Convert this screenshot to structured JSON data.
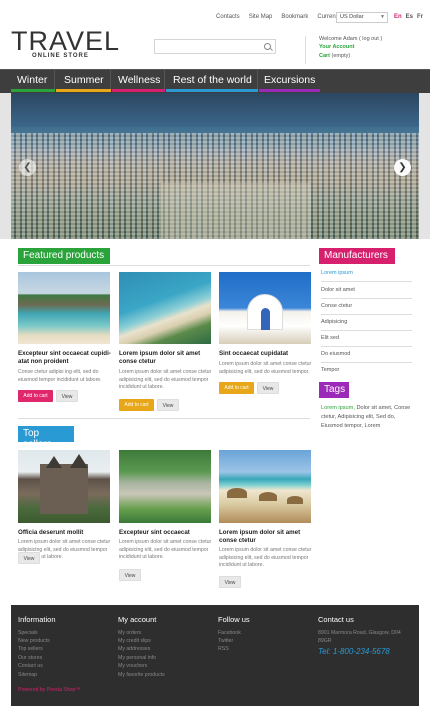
{
  "top": {
    "links": [
      "Contacts",
      "Site Map",
      "Bookmark"
    ],
    "currencies_label": "Currencies:",
    "currency_selected": "US Dollar",
    "langs": [
      "En",
      "Es",
      "Fr"
    ],
    "lang_colors": [
      "#d6206e",
      "#555555",
      "#555555"
    ]
  },
  "logo": {
    "main": "TRAVEL",
    "sub": "ONLINE STORE"
  },
  "search": {
    "placeholder": ""
  },
  "account": {
    "welcome": "Welcome Adam ( log out )",
    "your_account": "Your Account",
    "cart_label": "Cart",
    "cart_status": "(empty)"
  },
  "nav": {
    "items": [
      {
        "label": "Winter",
        "color": "#2aa43a"
      },
      {
        "label": "Summer",
        "color": "#e8a718"
      },
      {
        "label": "Wellness",
        "color": "#d6206e"
      },
      {
        "label": "Rest of the world",
        "color": "#2a9ad4"
      },
      {
        "label": "Excursions",
        "color": "#9c2ab8"
      }
    ]
  },
  "featured": {
    "title": "Featured products",
    "title_color": "#2aa43a",
    "products": [
      {
        "name": "Excepteur sint occaecat cupidi-atat non proident",
        "desc": "Conse ctetur adipisi ing elit, sed do eiusmod tempor incididunt ut labore.",
        "cart": "Add to cart",
        "view": "View"
      },
      {
        "name": "Lorem ipsum dolor sit amet conse ctetur",
        "desc": "Lorem ipsum dolor sit amet conse ctetur adipisicing elit, sed do eiusmod tempor incididunt ut labore.",
        "cart": "Add to cart",
        "view": "View"
      },
      {
        "name": "Sint occaecat cupidatat",
        "desc": "Lorem ipsum dolor sit amet conse ctetur adipisicing elit, sed do eiusmod tempor.",
        "cart": "Add to cart",
        "view": "View"
      }
    ]
  },
  "top_sellers": {
    "title": "Top sellers",
    "title_color": "#2a9ad4",
    "products": [
      {
        "name": "Officia deserunt mollit",
        "desc": "Lorem ipsum dolor sit amet conse ctetur adipisicing elit, sed do eiusmod tempor incididunt ut labore.",
        "view": "View"
      },
      {
        "name": "Excepteur sint occaecat",
        "desc": "Lorem ipsum dolor sit amet conse ctetur adipisicing elit, sed do eiusmod tempor incididunt ut labore.",
        "view": "View"
      },
      {
        "name": "Lorem ipsum dolor sit amet conse ctetur",
        "desc": "Lorem ipsum dolor sit amet conse ctetur adipisicing elit, sed do eiusmod tempor incididunt ut labore.",
        "view": "View"
      }
    ]
  },
  "manufacturers": {
    "title": "Manufacturers",
    "title_color": "#d6206e",
    "items": [
      "Lorem ipsum",
      "Dolor sit amet",
      "Conse ctetur",
      "Adipisicing",
      "Elit sed",
      "Do eiusmod",
      "Tempor"
    ]
  },
  "tags": {
    "title": "Tags",
    "title_color": "#9c2ab8",
    "text_green": "Lorem ipsum,",
    "text": "Dolor sit amet, Conse ctetur, Adipisicing elit, Sed do, Eiusmod tempor, Lorem"
  },
  "footer": {
    "information": {
      "title": "Information",
      "links": [
        "Specials",
        "New products",
        "Top sellers",
        "Our stores",
        "Contact us",
        "Sitemap"
      ]
    },
    "powered": "Powered by Presta Shop™",
    "my_account": {
      "title": "My account",
      "links": [
        "My orders",
        "My credit slips",
        "My addresses",
        "My personal info",
        "My vouchers",
        "My favorite products"
      ]
    },
    "follow_us": {
      "title": "Follow us",
      "links": [
        "Facebook",
        "Twitter",
        "RSS"
      ]
    },
    "contact": {
      "title": "Contact us",
      "address": "8901 Marmora Road, Glasgow, D04 89GR",
      "phone": "Tel: 1-800-234-5678"
    }
  }
}
